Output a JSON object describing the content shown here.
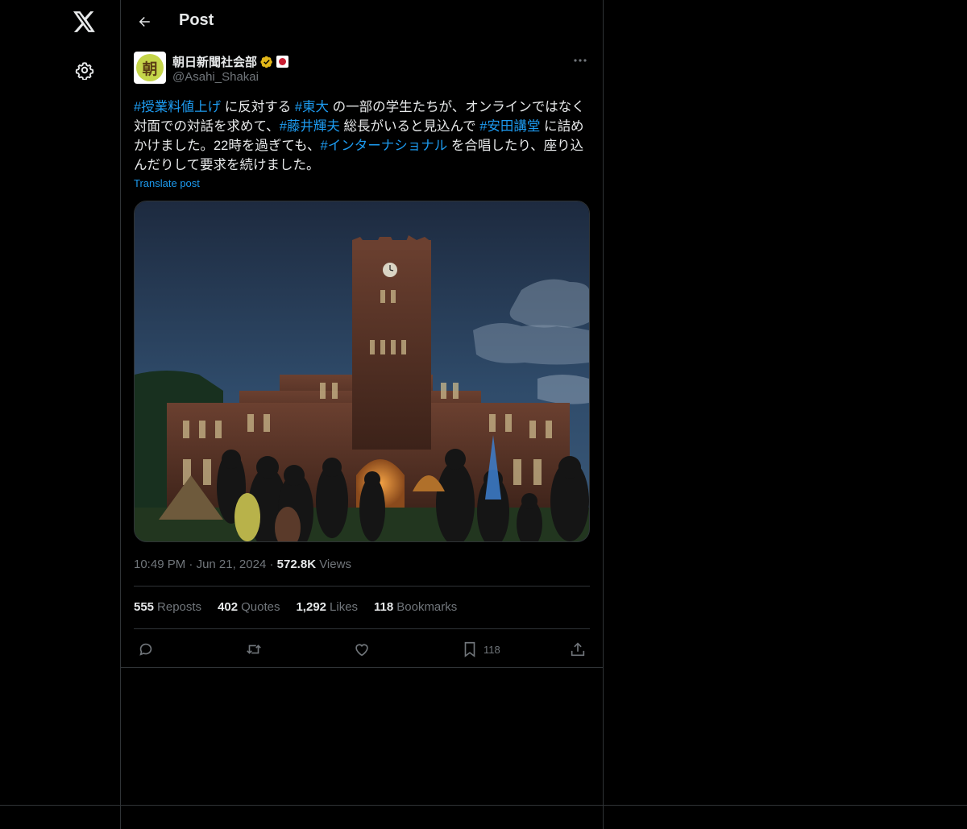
{
  "nav": {
    "logo": "x-logo-icon",
    "settings": "gear-icon"
  },
  "header": {
    "title": "Post"
  },
  "post": {
    "author": {
      "display_name": "朝日新聞社会部",
      "handle": "@Asahi_Shakai",
      "avatar_glyph": "朝",
      "verified_color": "#e2b719"
    },
    "text": [
      {
        "t": "#授業料値上げ",
        "tag": true
      },
      {
        "t": " に反対する ",
        "tag": false
      },
      {
        "t": "#東大",
        "tag": true
      },
      {
        "t": " の一部の学生たちが、オンラインではなく対面での対話を求めて、",
        "tag": false
      },
      {
        "t": "#藤井輝夫",
        "tag": true
      },
      {
        "t": " 総長がいると見込んで ",
        "tag": false
      },
      {
        "t": "#安田講堂",
        "tag": true
      },
      {
        "t": " に詰めかけました。22時を過ぎても、",
        "tag": false
      },
      {
        "t": "#インターナショナル",
        "tag": true
      },
      {
        "t": " を合唱したり、座り込んだりして要求を続けました。",
        "tag": false
      }
    ],
    "translate_label": "Translate post",
    "time": "10:49 PM",
    "date": "Jun 21, 2024",
    "views_count": "572.8K",
    "views_label": "Views",
    "stats": {
      "reposts": "555",
      "reposts_label": "Reposts",
      "quotes": "402",
      "quotes_label": "Quotes",
      "likes": "1,292",
      "likes_label": "Likes",
      "bookmarks": "118",
      "bookmarks_label": "Bookmarks"
    },
    "bookmark_action_count": "118"
  },
  "colors": {
    "accent": "#1d9bf0",
    "muted": "#71767b",
    "border": "#2f3336"
  }
}
